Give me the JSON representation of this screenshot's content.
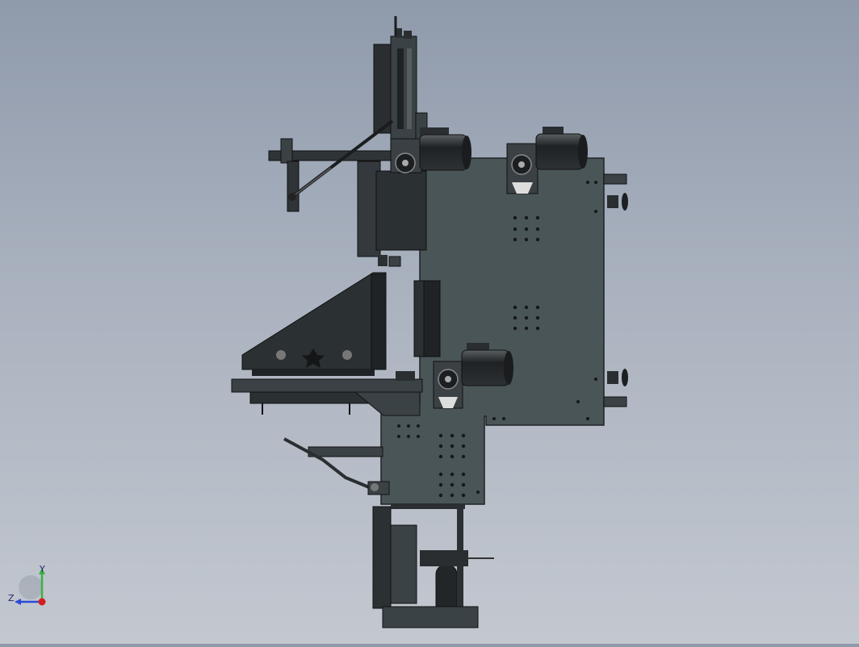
{
  "viewport": {
    "background_top": "#8f9aab",
    "background_bottom": "#c3c8d0",
    "part_color": "#4a5558",
    "dark_color": "#222629"
  },
  "triad": {
    "y_label": "Y",
    "z_label": "Z",
    "y_color": "#3cb043",
    "z_color": "#2b4bd6",
    "x_color": "#d21f1f"
  }
}
